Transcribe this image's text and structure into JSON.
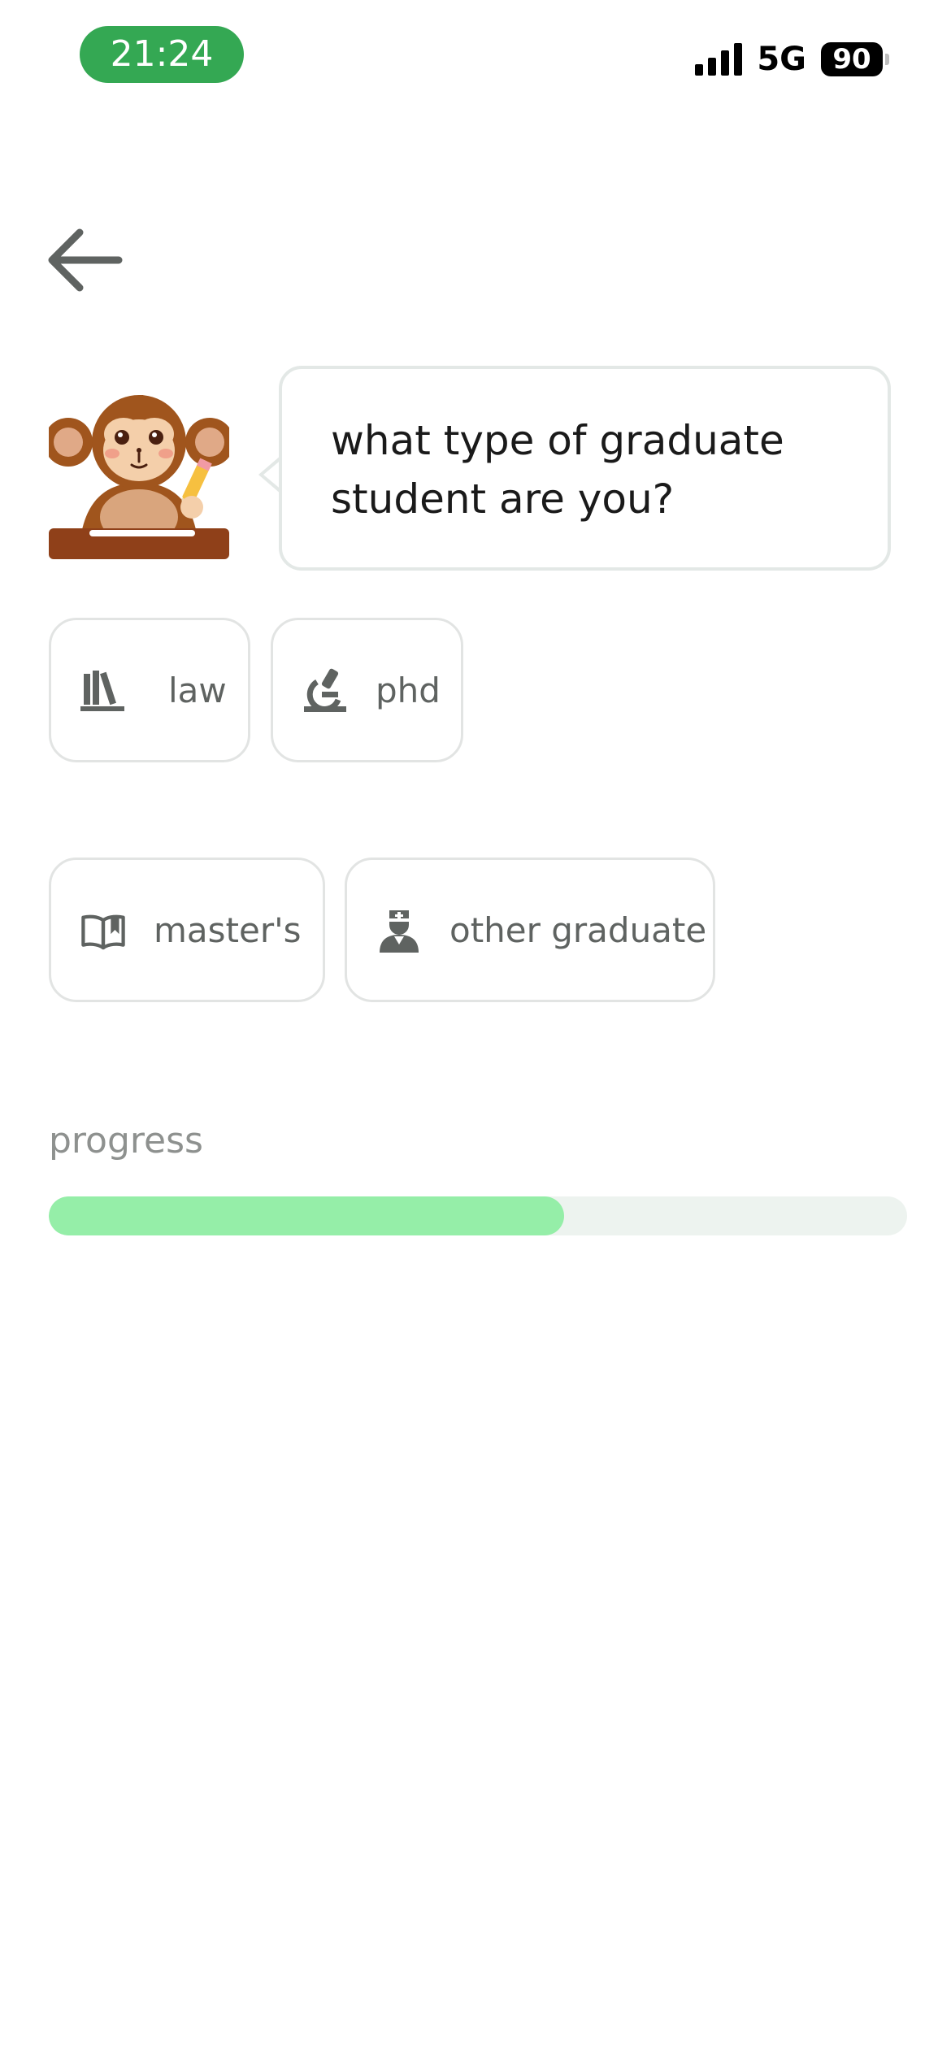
{
  "status_bar": {
    "time": "21:24",
    "network": "5G",
    "battery": "90"
  },
  "colors": {
    "time_pill": "#34a853",
    "progress_fill": "#95eea8",
    "progress_track": "#edf3ef",
    "chip_border": "#e2e4e3",
    "text_primary": "#1a1a1a",
    "text_secondary": "#5f6361"
  },
  "question": {
    "text": "what type of graduate student are you?"
  },
  "options": [
    {
      "label": "law",
      "icon": "books-icon"
    },
    {
      "label": "phd",
      "icon": "microscope-icon"
    },
    {
      "label": "master's",
      "icon": "open-book-icon"
    },
    {
      "label": "other graduate",
      "icon": "doctor-icon"
    }
  ],
  "progress": {
    "label": "progress",
    "fraction": 0.6
  }
}
